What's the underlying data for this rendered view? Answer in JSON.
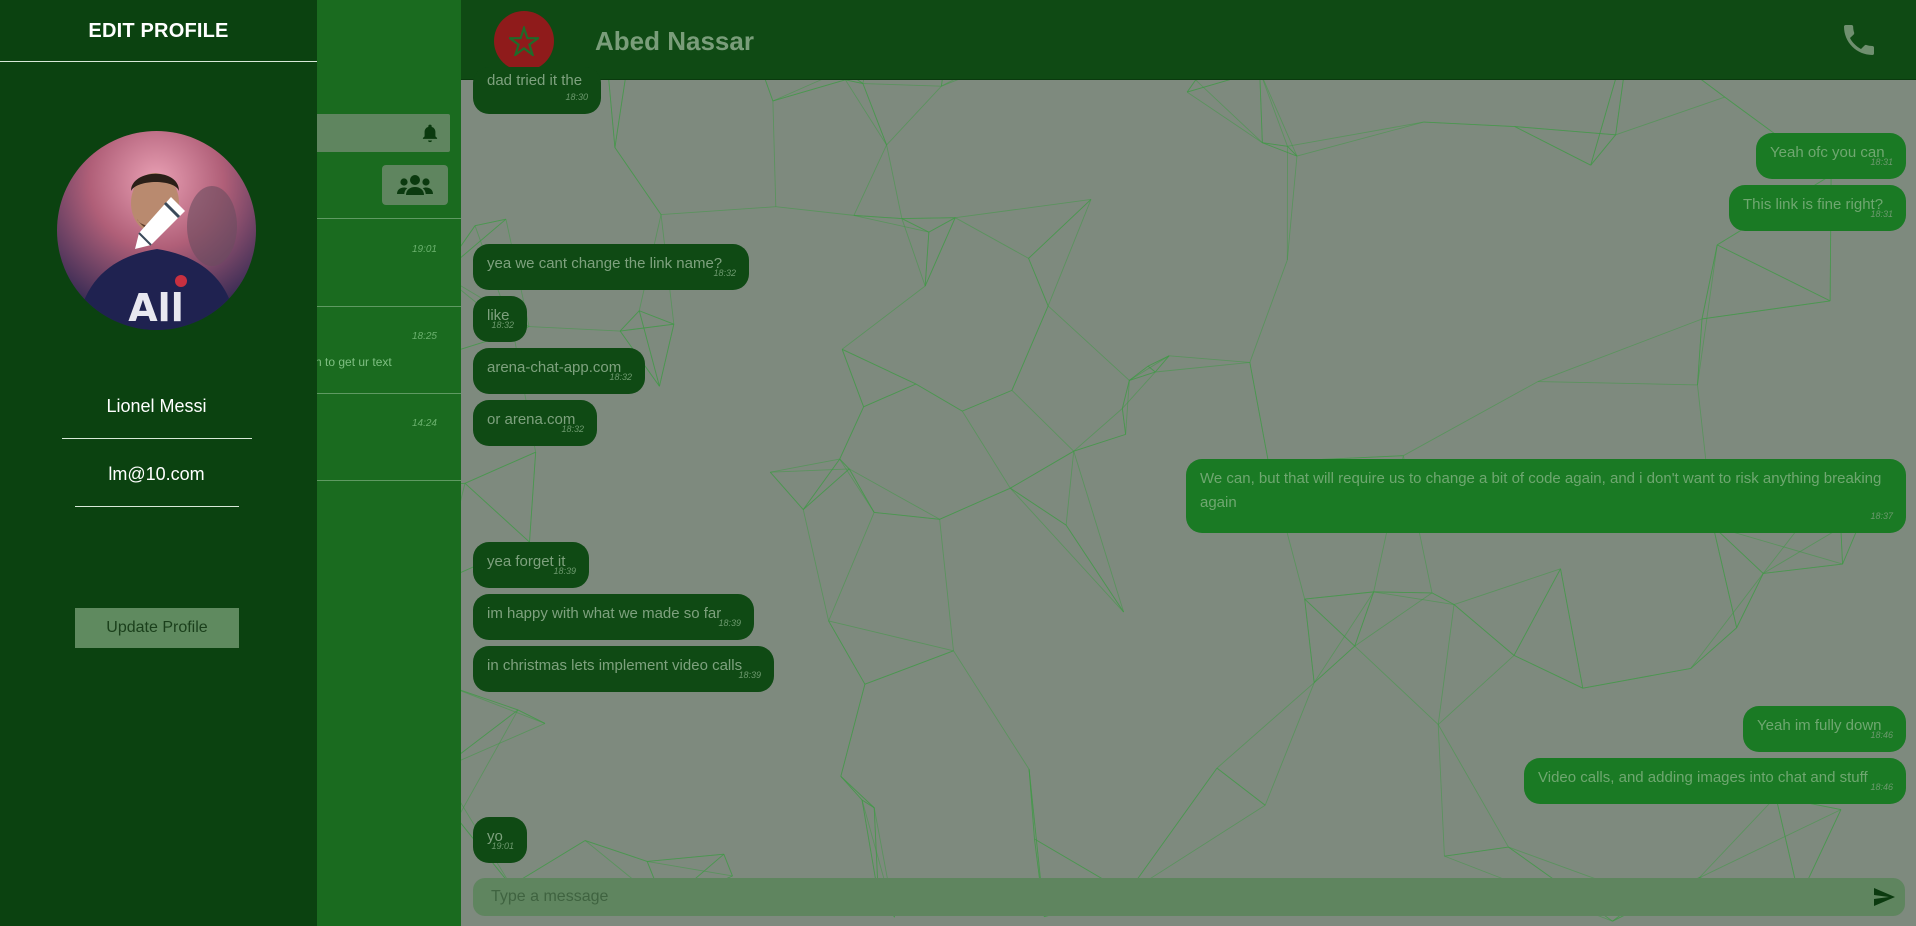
{
  "profile_panel": {
    "title": "EDIT PROFILE",
    "name": "Lionel Messi",
    "email": "lm@10.com",
    "update_label": "Update Profile",
    "avatar_icon": "edit-pencil-icon"
  },
  "sidebar": {
    "chats": [
      {
        "time": "19:01",
        "preview": ""
      },
      {
        "time": "18:25",
        "preview": "n to get ur text"
      },
      {
        "time": "14:24",
        "preview": ""
      }
    ],
    "notification_icon": "bell-icon",
    "groups_icon": "users-group-icon"
  },
  "header": {
    "contact_name": "Abed Nassar",
    "call_icon": "phone-icon"
  },
  "messages": [
    {
      "dir": "in",
      "text": "dad tried it the",
      "time": "18:30"
    },
    {
      "dir": "out",
      "text": "Yeah ofc you can",
      "time": "18:31"
    },
    {
      "dir": "out",
      "text": "This link is fine right?",
      "time": "18:31"
    },
    {
      "dir": "in",
      "text": "yea we cant change the link name?",
      "time": "18:32"
    },
    {
      "dir": "in",
      "text": "like",
      "time": "18:32"
    },
    {
      "dir": "in",
      "text": "arena-chat-app.com",
      "time": "18:32"
    },
    {
      "dir": "in",
      "text": "or arena.com",
      "time": "18:32"
    },
    {
      "dir": "out",
      "text": "We can, but that will require us to change a bit of code again, and i don't want to risk anything breaking again",
      "time": "18:37"
    },
    {
      "dir": "in",
      "text": "yea forget it",
      "time": "18:39"
    },
    {
      "dir": "in",
      "text": "im happy with what we made so far",
      "time": "18:39"
    },
    {
      "dir": "in",
      "text": "in christmas lets implement video calls",
      "time": "18:39"
    },
    {
      "dir": "out",
      "text": "Yeah im fully down",
      "time": "18:46"
    },
    {
      "dir": "out",
      "text": "Video calls, and adding images into chat and stuff",
      "time": "18:46"
    },
    {
      "dir": "in",
      "text": "yo",
      "time": "19:01"
    }
  ],
  "composer": {
    "placeholder": "Type a message",
    "send_icon": "send-icon"
  },
  "colors": {
    "panel_bg": "#0b4210",
    "sidebar_bg": "#1a6b1f",
    "header_bg": "#0f4a14",
    "incoming_bubble": "#0f4a14",
    "outgoing_bubble": "#1a7a24",
    "chat_bg": "#7e8a7e"
  }
}
